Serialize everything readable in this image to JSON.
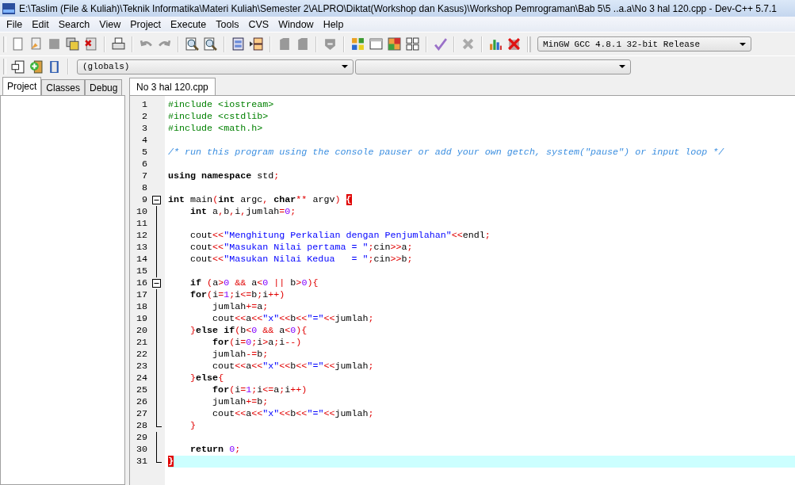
{
  "window": {
    "title": "E:\\Taslim (File & Kuliah)\\Teknik Informatika\\Materi Kuliah\\Semester 2\\ALPRO\\Diktat(Workshop dan Kasus)\\Workshop Pemrograman\\Bab 5\\5 ..a.a\\No 3 hal 120.cpp - Dev-C++ 5.7.1"
  },
  "menu": [
    "File",
    "Edit",
    "Search",
    "View",
    "Project",
    "Execute",
    "Tools",
    "CVS",
    "Window",
    "Help"
  ],
  "compiler_select": {
    "value": "MinGW GCC 4.8.1 32-bit Release"
  },
  "scope_select": {
    "value": "(globals)"
  },
  "side_tabs": [
    {
      "label": "Project",
      "selected": true
    },
    {
      "label": "Classes",
      "selected": false
    },
    {
      "label": "Debug",
      "selected": false
    }
  ],
  "editor_tabs": [
    {
      "label": "No 3 hal 120.cpp",
      "selected": true
    }
  ],
  "code": [
    {
      "num": "1",
      "kind": "plain",
      "current": false,
      "tokens": [
        {
          "kind": "pp",
          "text": "#include <iostream>"
        }
      ]
    },
    {
      "num": "2",
      "kind": "plain",
      "current": false,
      "tokens": [
        {
          "kind": "pp",
          "text": "#include <cstdlib>"
        }
      ]
    },
    {
      "num": "3",
      "kind": "plain",
      "current": false,
      "tokens": [
        {
          "kind": "pp",
          "text": "#include <math.h>"
        }
      ]
    },
    {
      "num": "4",
      "kind": "plain",
      "current": false
    },
    {
      "num": "5",
      "kind": "plain",
      "current": false,
      "tokens": [
        {
          "kind": "cm",
          "text": "/* run this program using the console pauser or add your own getch, system(\"pause\") or input loop */"
        }
      ]
    },
    {
      "num": "6",
      "kind": "plain",
      "current": false
    },
    {
      "num": "7",
      "kind": "plain",
      "current": false,
      "tokens": [
        {
          "kind": "kw",
          "text": "using namespace"
        },
        {
          "kind": "id",
          "text": " std"
        },
        {
          "kind": "sym",
          "text": ";"
        }
      ]
    },
    {
      "num": "8",
      "kind": "plain",
      "current": false
    },
    {
      "num": "9",
      "kind": "fold-start",
      "current": false,
      "tokens": [
        {
          "kind": "kw",
          "text": "int"
        },
        {
          "kind": "id",
          "text": " main"
        },
        {
          "kind": "sym",
          "text": "("
        },
        {
          "kind": "kw",
          "text": "int"
        },
        {
          "kind": "id",
          "text": " argc"
        },
        {
          "kind": "sym",
          "text": ","
        },
        {
          "kind": "kw",
          "text": " char"
        },
        {
          "kind": "sym",
          "text": "**"
        },
        {
          "kind": "id",
          "text": " argv"
        },
        {
          "kind": "sym",
          "text": ") "
        },
        {
          "kind": "bm",
          "text": "{"
        }
      ]
    },
    {
      "num": "10",
      "kind": "fold-line",
      "current": false,
      "tokens": [
        {
          "kind": "kw",
          "text": "    int"
        },
        {
          "kind": "id",
          "text": " a"
        },
        {
          "kind": "sym",
          "text": ","
        },
        {
          "kind": "id",
          "text": "b"
        },
        {
          "kind": "sym",
          "text": ","
        },
        {
          "kind": "id",
          "text": "i"
        },
        {
          "kind": "sym",
          "text": ","
        },
        {
          "kind": "id",
          "text": "jumlah"
        },
        {
          "kind": "sym",
          "text": "="
        },
        {
          "kind": "num",
          "text": "0"
        },
        {
          "kind": "sym",
          "text": ";"
        }
      ]
    },
    {
      "num": "11",
      "kind": "fold-line",
      "current": false
    },
    {
      "num": "12",
      "kind": "fold-line",
      "current": false,
      "tokens": [
        {
          "kind": "id",
          "text": "    cout"
        },
        {
          "kind": "sym",
          "text": "<<"
        },
        {
          "kind": "str",
          "text": "\"Menghitung Perkalian dengan Penjumlahan\""
        },
        {
          "kind": "sym",
          "text": "<<"
        },
        {
          "kind": "id",
          "text": "endl"
        },
        {
          "kind": "sym",
          "text": ";"
        }
      ]
    },
    {
      "num": "13",
      "kind": "fold-line",
      "current": false,
      "tokens": [
        {
          "kind": "id",
          "text": "    cout"
        },
        {
          "kind": "sym",
          "text": "<<"
        },
        {
          "kind": "str",
          "text": "\"Masukan Nilai pertama = \""
        },
        {
          "kind": "sym",
          "text": ";"
        },
        {
          "kind": "id",
          "text": "cin"
        },
        {
          "kind": "sym",
          "text": ">>"
        },
        {
          "kind": "id",
          "text": "a"
        },
        {
          "kind": "sym",
          "text": ";"
        }
      ]
    },
    {
      "num": "14",
      "kind": "fold-line",
      "current": false,
      "tokens": [
        {
          "kind": "id",
          "text": "    cout"
        },
        {
          "kind": "sym",
          "text": "<<"
        },
        {
          "kind": "str",
          "text": "\"Masukan Nilai Kedua   = \""
        },
        {
          "kind": "sym",
          "text": ";"
        },
        {
          "kind": "id",
          "text": "cin"
        },
        {
          "kind": "sym",
          "text": ">>"
        },
        {
          "kind": "id",
          "text": "b"
        },
        {
          "kind": "sym",
          "text": ";"
        }
      ]
    },
    {
      "num": "15",
      "kind": "fold-line",
      "current": false
    },
    {
      "num": "16",
      "kind": "fold-start",
      "current": false,
      "tokens": [
        {
          "kind": "kw",
          "text": "    if"
        },
        {
          "kind": "sym",
          "text": " ("
        },
        {
          "kind": "id",
          "text": "a"
        },
        {
          "kind": "sym",
          "text": ">"
        },
        {
          "kind": "num",
          "text": "0"
        },
        {
          "kind": "sym",
          "text": " &&"
        },
        {
          "kind": "id",
          "text": " a"
        },
        {
          "kind": "sym",
          "text": "<"
        },
        {
          "kind": "num",
          "text": "0"
        },
        {
          "kind": "sym",
          "text": " ||"
        },
        {
          "kind": "id",
          "text": " b"
        },
        {
          "kind": "sym",
          "text": ">"
        },
        {
          "kind": "num",
          "text": "0"
        },
        {
          "kind": "sym",
          "text": "){"
        }
      ]
    },
    {
      "num": "17",
      "kind": "fold-line",
      "current": false,
      "tokens": [
        {
          "kind": "kw",
          "text": "    for"
        },
        {
          "kind": "sym",
          "text": "("
        },
        {
          "kind": "id",
          "text": "i"
        },
        {
          "kind": "sym",
          "text": "="
        },
        {
          "kind": "num",
          "text": "1"
        },
        {
          "kind": "sym",
          "text": ";"
        },
        {
          "kind": "id",
          "text": "i"
        },
        {
          "kind": "sym",
          "text": "<="
        },
        {
          "kind": "id",
          "text": "b"
        },
        {
          "kind": "sym",
          "text": ";"
        },
        {
          "kind": "id",
          "text": "i"
        },
        {
          "kind": "sym",
          "text": "++)"
        }
      ]
    },
    {
      "num": "18",
      "kind": "fold-line",
      "current": false,
      "tokens": [
        {
          "kind": "id",
          "text": "        jumlah"
        },
        {
          "kind": "sym",
          "text": "+="
        },
        {
          "kind": "id",
          "text": "a"
        },
        {
          "kind": "sym",
          "text": ";"
        }
      ]
    },
    {
      "num": "19",
      "kind": "fold-line",
      "current": false,
      "tokens": [
        {
          "kind": "id",
          "text": "        cout"
        },
        {
          "kind": "sym",
          "text": "<<"
        },
        {
          "kind": "id",
          "text": "a"
        },
        {
          "kind": "sym",
          "text": "<<"
        },
        {
          "kind": "str",
          "text": "\"x\""
        },
        {
          "kind": "sym",
          "text": "<<"
        },
        {
          "kind": "id",
          "text": "b"
        },
        {
          "kind": "sym",
          "text": "<<"
        },
        {
          "kind": "str",
          "text": "\"=\""
        },
        {
          "kind": "sym",
          "text": "<<"
        },
        {
          "kind": "id",
          "text": "jumlah"
        },
        {
          "kind": "sym",
          "text": ";"
        }
      ]
    },
    {
      "num": "20",
      "kind": "fold-line",
      "current": false,
      "tokens": [
        {
          "kind": "sym",
          "text": "    }"
        },
        {
          "kind": "kw",
          "text": "else if"
        },
        {
          "kind": "sym",
          "text": "("
        },
        {
          "kind": "id",
          "text": "b"
        },
        {
          "kind": "sym",
          "text": "<"
        },
        {
          "kind": "num",
          "text": "0"
        },
        {
          "kind": "sym",
          "text": " &&"
        },
        {
          "kind": "id",
          "text": " a"
        },
        {
          "kind": "sym",
          "text": "<"
        },
        {
          "kind": "num",
          "text": "0"
        },
        {
          "kind": "sym",
          "text": "){"
        }
      ]
    },
    {
      "num": "21",
      "kind": "fold-line",
      "current": false,
      "tokens": [
        {
          "kind": "kw",
          "text": "        for"
        },
        {
          "kind": "sym",
          "text": "("
        },
        {
          "kind": "id",
          "text": "i"
        },
        {
          "kind": "sym",
          "text": "="
        },
        {
          "kind": "num",
          "text": "0"
        },
        {
          "kind": "sym",
          "text": ";"
        },
        {
          "kind": "id",
          "text": "i"
        },
        {
          "kind": "sym",
          "text": ">"
        },
        {
          "kind": "id",
          "text": "a"
        },
        {
          "kind": "sym",
          "text": ";"
        },
        {
          "kind": "id",
          "text": "i"
        },
        {
          "kind": "sym",
          "text": "--)"
        }
      ]
    },
    {
      "num": "22",
      "kind": "fold-line",
      "current": false,
      "tokens": [
        {
          "kind": "id",
          "text": "        jumlah"
        },
        {
          "kind": "sym",
          "text": "-="
        },
        {
          "kind": "id",
          "text": "b"
        },
        {
          "kind": "sym",
          "text": ";"
        }
      ]
    },
    {
      "num": "23",
      "kind": "fold-line",
      "current": false,
      "tokens": [
        {
          "kind": "id",
          "text": "        cout"
        },
        {
          "kind": "sym",
          "text": "<<"
        },
        {
          "kind": "id",
          "text": "a"
        },
        {
          "kind": "sym",
          "text": "<<"
        },
        {
          "kind": "str",
          "text": "\"x\""
        },
        {
          "kind": "sym",
          "text": "<<"
        },
        {
          "kind": "id",
          "text": "b"
        },
        {
          "kind": "sym",
          "text": "<<"
        },
        {
          "kind": "str",
          "text": "\"=\""
        },
        {
          "kind": "sym",
          "text": "<<"
        },
        {
          "kind": "id",
          "text": "jumlah"
        },
        {
          "kind": "sym",
          "text": ";"
        }
      ]
    },
    {
      "num": "24",
      "kind": "fold-line",
      "current": false,
      "tokens": [
        {
          "kind": "sym",
          "text": "    }"
        },
        {
          "kind": "kw",
          "text": "else"
        },
        {
          "kind": "sym",
          "text": "{"
        }
      ]
    },
    {
      "num": "25",
      "kind": "fold-line",
      "current": false,
      "tokens": [
        {
          "kind": "kw",
          "text": "        for"
        },
        {
          "kind": "sym",
          "text": "("
        },
        {
          "kind": "id",
          "text": "i"
        },
        {
          "kind": "sym",
          "text": "="
        },
        {
          "kind": "num",
          "text": "1"
        },
        {
          "kind": "sym",
          "text": ";"
        },
        {
          "kind": "id",
          "text": "i"
        },
        {
          "kind": "sym",
          "text": "<="
        },
        {
          "kind": "id",
          "text": "a"
        },
        {
          "kind": "sym",
          "text": ";"
        },
        {
          "kind": "id",
          "text": "i"
        },
        {
          "kind": "sym",
          "text": "++)"
        }
      ]
    },
    {
      "num": "26",
      "kind": "fold-line",
      "current": false,
      "tokens": [
        {
          "kind": "id",
          "text": "        jumlah"
        },
        {
          "kind": "sym",
          "text": "+="
        },
        {
          "kind": "id",
          "text": "b"
        },
        {
          "kind": "sym",
          "text": ";"
        }
      ]
    },
    {
      "num": "27",
      "kind": "fold-line",
      "current": false,
      "tokens": [
        {
          "kind": "id",
          "text": "        cout"
        },
        {
          "kind": "sym",
          "text": "<<"
        },
        {
          "kind": "id",
          "text": "a"
        },
        {
          "kind": "sym",
          "text": "<<"
        },
        {
          "kind": "str",
          "text": "\"x\""
        },
        {
          "kind": "sym",
          "text": "<<"
        },
        {
          "kind": "id",
          "text": "b"
        },
        {
          "kind": "sym",
          "text": "<<"
        },
        {
          "kind": "str",
          "text": "\"=\""
        },
        {
          "kind": "sym",
          "text": "<<"
        },
        {
          "kind": "id",
          "text": "jumlah"
        },
        {
          "kind": "sym",
          "text": ";"
        }
      ]
    },
    {
      "num": "28",
      "kind": "fold-end",
      "current": false,
      "tokens": [
        {
          "kind": "sym",
          "text": "    }"
        }
      ]
    },
    {
      "num": "29",
      "kind": "fold-line",
      "current": false
    },
    {
      "num": "30",
      "kind": "fold-line",
      "current": false,
      "tokens": [
        {
          "kind": "kw",
          "text": "    return"
        },
        {
          "kind": "num",
          "text": " 0"
        },
        {
          "kind": "sym",
          "text": ";"
        }
      ]
    },
    {
      "num": "31",
      "kind": "fold-end",
      "current": true,
      "tokens": [
        {
          "kind": "bm",
          "text": "}"
        }
      ]
    }
  ]
}
